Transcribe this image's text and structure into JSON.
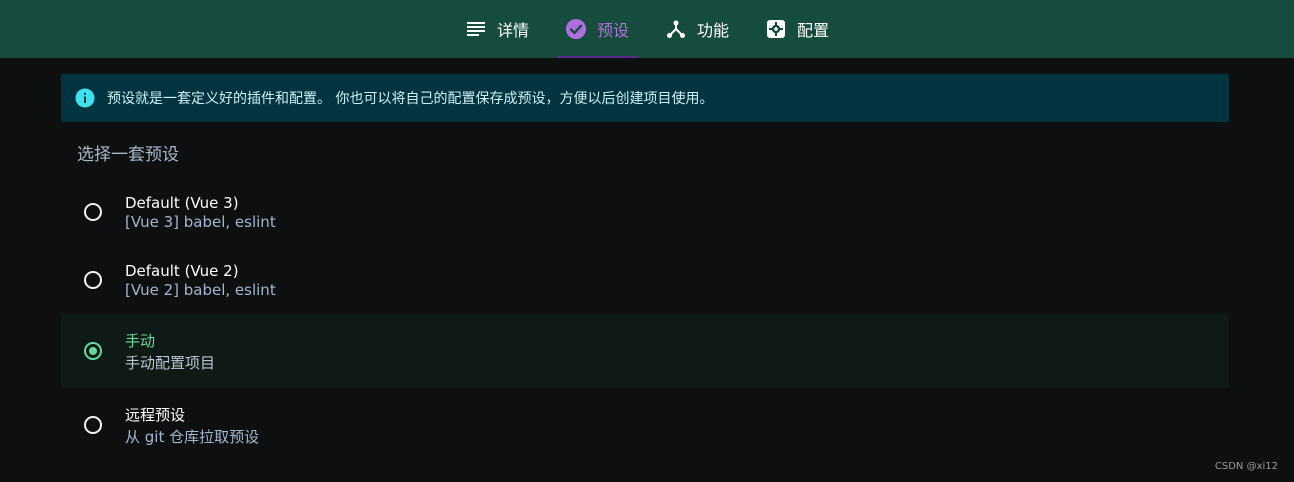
{
  "tabs": [
    {
      "label": "详情",
      "icon": "list-icon",
      "active": false
    },
    {
      "label": "预设",
      "icon": "check-circle-icon",
      "active": true
    },
    {
      "label": "功能",
      "icon": "fork-icon",
      "active": false
    },
    {
      "label": "配置",
      "icon": "settings-box-icon",
      "active": false
    }
  ],
  "info": {
    "icon": "info-icon",
    "text": "预设就是一套定义好的插件和配置。 你也可以将自己的配置保存成预设，方便以后创建项目使用。"
  },
  "section_title": "选择一套预设",
  "presets": [
    {
      "name": "Default (Vue 3)",
      "description": "[Vue 3] babel, eslint",
      "selected": false
    },
    {
      "name": "Default (Vue 2)",
      "description": "[Vue 2] babel, eslint",
      "selected": false
    },
    {
      "name": "手动",
      "description": "手动配置项目",
      "selected": true
    },
    {
      "name": "远程预设",
      "description": "从 git 仓库拉取预设",
      "selected": false
    }
  ],
  "watermark": "CSDN @xi12",
  "colors": {
    "header_bg": "#164c3d",
    "active_tab": "#b06fe0",
    "selected_accent": "#63d99b",
    "info_bg": "#02343f",
    "page_bg": "#0e0f11"
  }
}
